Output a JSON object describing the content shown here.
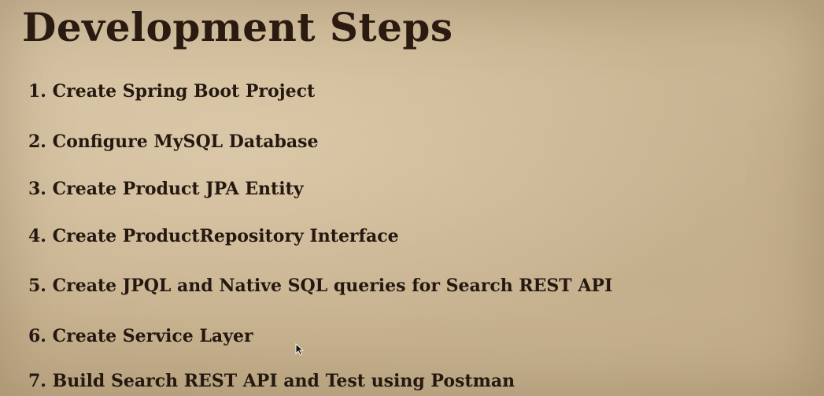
{
  "slide": {
    "title": "Development Steps",
    "steps": [
      "1. Create Spring Boot Project",
      "2. Configure MySQL Database",
      "3. Create Product JPA Entity",
      "4. Create ProductRepository Interface",
      "5. Create JPQL and Native SQL queries for Search REST API",
      "6. Create Service Layer",
      "7. Build Search REST API and Test using Postman"
    ]
  },
  "cursor": {
    "icon": "mouse-pointer-icon"
  },
  "colors": {
    "background": "#cdb996",
    "text": "#241810"
  }
}
